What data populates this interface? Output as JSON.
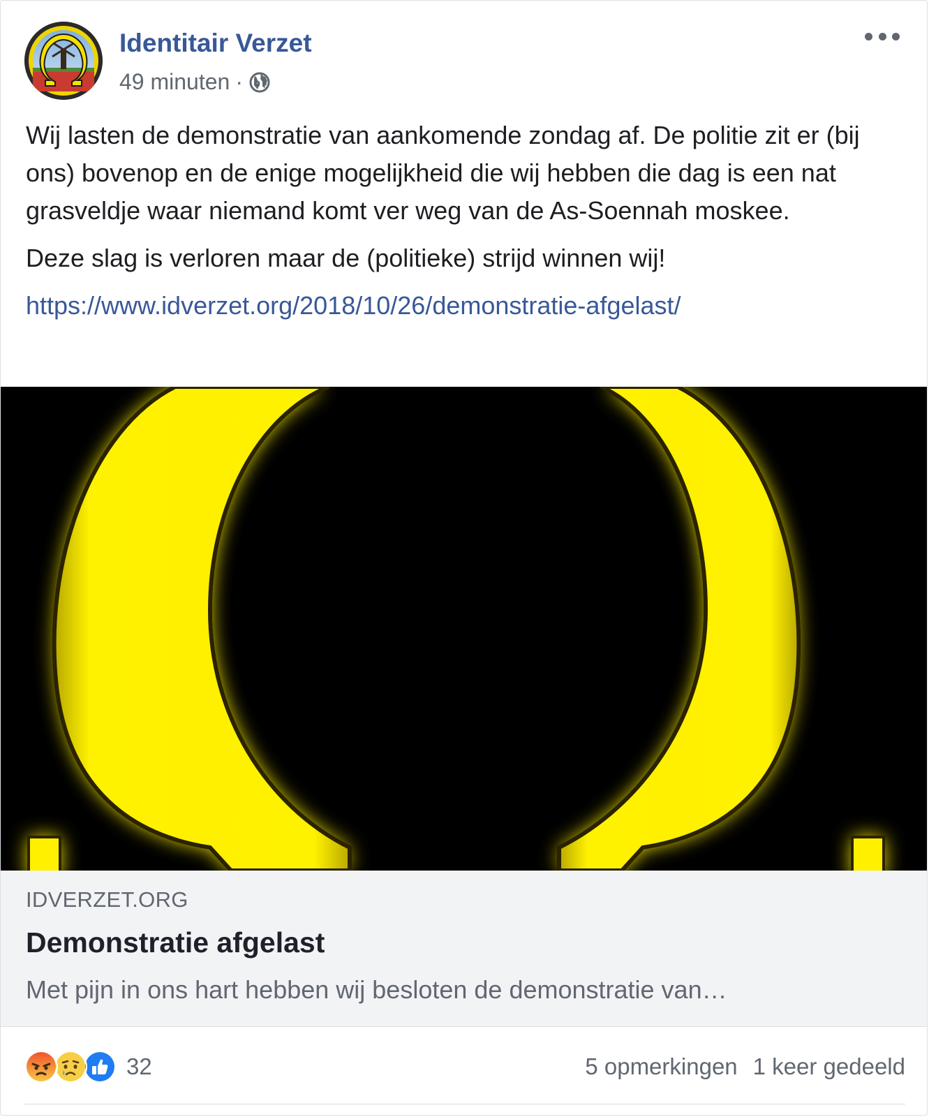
{
  "post": {
    "author": "Identitair Verzet",
    "time": "49 minuten",
    "separator": "·",
    "privacy_icon": "globe-icon",
    "more_icon": "more-dots-icon",
    "paragraphs": [
      "Wij lasten de demonstratie van aankomende zondag af. De politie zit er (bij ons) bovenop en de enige mogelijkheid die wij hebben die dag is een nat grasveldje waar niemand komt ver weg van de As-Soennah moskee.",
      "Deze slag is verloren maar de (politieke) strijd winnen wij!"
    ],
    "link": "https://www.idverzet.org/2018/10/26/demonstratie-afgelast/"
  },
  "preview": {
    "image_icon": "omega-logo",
    "domain": "IDVERZET.ORG",
    "title": "Demonstratie afgelast",
    "description": "Met pijn in ons hart hebben wij besloten de demonstratie van…"
  },
  "footer": {
    "reactions": [
      "angry-icon",
      "sad-icon",
      "like-icon"
    ],
    "reaction_count": "32",
    "comments": "5 opmerkingen",
    "shares": "1 keer gedeeld"
  },
  "colors": {
    "link": "#385898",
    "muted": "#606770",
    "omega_yellow": "#ffe600"
  }
}
